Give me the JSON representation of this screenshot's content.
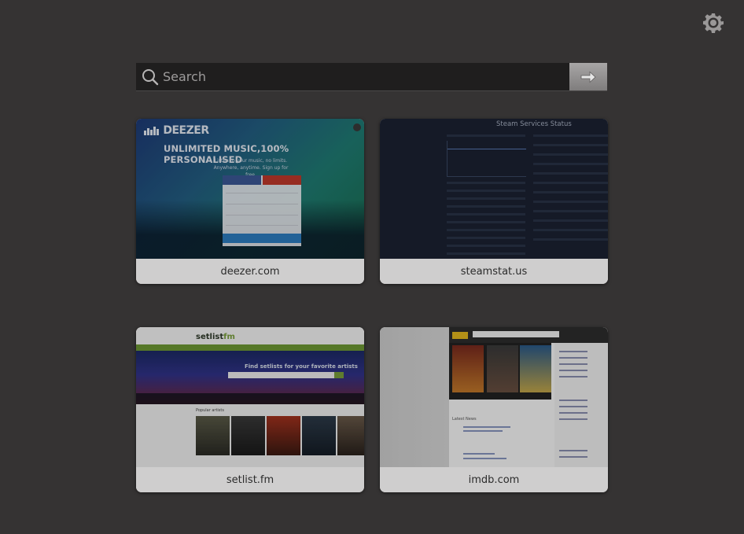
{
  "settings": {
    "icon": "gear-icon"
  },
  "search": {
    "placeholder": "Search",
    "value": "",
    "go_icon": "arrow-right-icon"
  },
  "tiles": [
    {
      "label": "deezer.com",
      "thumb": {
        "brand": "DEEZER",
        "headline": "UNLIMITED MUSIC,100% PERSONALISED",
        "sub": "Listen to your music, no limits. Anywhere, anytime. Sign up for free."
      }
    },
    {
      "label": "steamstat.us",
      "thumb": {
        "title": "Steam Services Status"
      }
    },
    {
      "label": "setlist.fm",
      "thumb": {
        "brand_a": "setlist",
        "brand_b": "fm",
        "headline": "Find setlists for your favorite artists",
        "section": "Popular artists"
      }
    },
    {
      "label": "imdb.com",
      "thumb": {
        "section": "Latest News"
      }
    }
  ],
  "colors": {
    "background": "#353333",
    "tile_label_bg": "#cfcece",
    "search_bg": "#1f1e1e"
  }
}
